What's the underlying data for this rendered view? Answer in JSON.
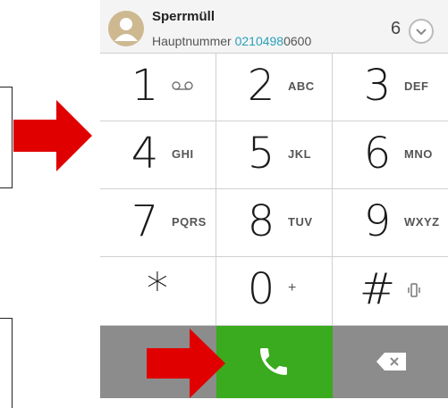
{
  "contact": {
    "name": "Sperrmüll",
    "label": "Hauptnummer",
    "number_prefix": "0210498",
    "number_suffix": "0600",
    "count": "6"
  },
  "keys": [
    {
      "digit": "1",
      "letters": "",
      "icon": "voicemail-icon"
    },
    {
      "digit": "2",
      "letters": "ABC"
    },
    {
      "digit": "3",
      "letters": "DEF"
    },
    {
      "digit": "4",
      "letters": "GHI"
    },
    {
      "digit": "5",
      "letters": "JKL"
    },
    {
      "digit": "6",
      "letters": "MNO"
    },
    {
      "digit": "7",
      "letters": "PQRS"
    },
    {
      "digit": "8",
      "letters": "TUV"
    },
    {
      "digit": "9",
      "letters": "WXYZ"
    },
    {
      "digit": "*",
      "letters": ""
    },
    {
      "digit": "0",
      "letters": "+"
    },
    {
      "digit": "#",
      "letters": "",
      "icon": "vibrate-icon"
    }
  ],
  "colors": {
    "call_green": "#3aaa1e",
    "bar_gray": "#8c8c8c",
    "arrow_red": "#e00000",
    "highlight": "#2a9fb8"
  }
}
